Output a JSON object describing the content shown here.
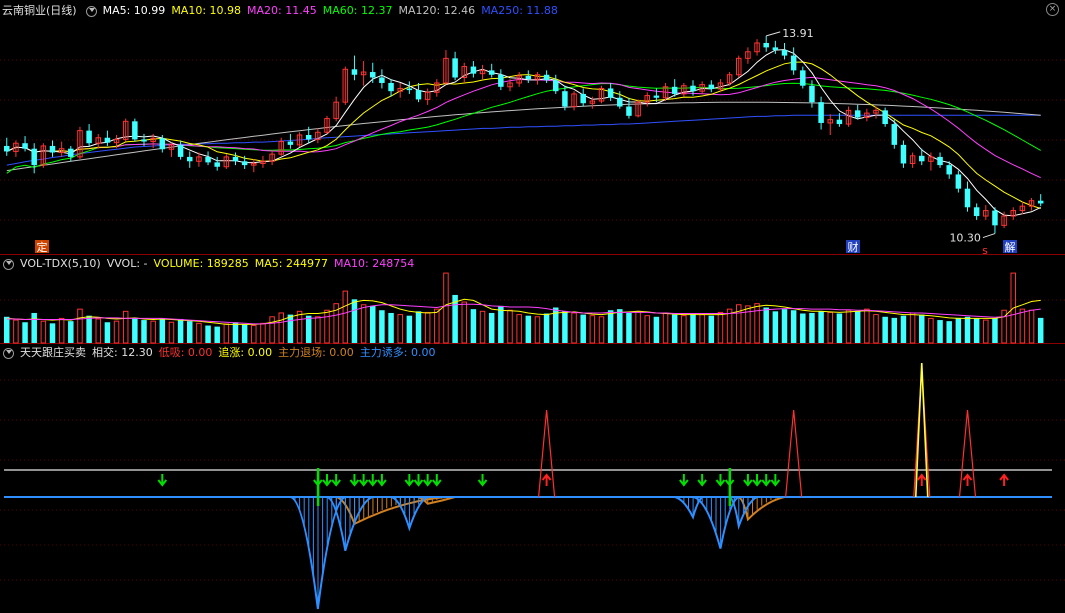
{
  "main_legend": {
    "title": "云南铜业(日线)",
    "ma": [
      {
        "label": "MA5: 10.99",
        "color": "#ffffff"
      },
      {
        "label": "MA10: 10.98",
        "color": "#ffff00"
      },
      {
        "label": "MA20: 11.45",
        "color": "#ff40ff"
      },
      {
        "label": "MA60: 12.37",
        "color": "#00ff00"
      },
      {
        "label": "MA120: 12.46",
        "color": "#c0c0c0"
      },
      {
        "label": "MA250: 11.88",
        "color": "#3050ff"
      }
    ]
  },
  "vol_legend": {
    "title": "VOL-TDX(5,10)",
    "items": [
      {
        "label": "VVOL: -",
        "color": "#e0e0e0"
      },
      {
        "label": "VOLUME: 189285",
        "color": "#ffff00"
      },
      {
        "label": "MA5: 244977",
        "color": "#ffff00"
      },
      {
        "label": "MA10: 248754",
        "color": "#ff40ff"
      }
    ]
  },
  "ind_legend": {
    "title": "天天跟庄买卖",
    "items": [
      {
        "label": "相交: 12.30",
        "color": "#e0e0e0"
      },
      {
        "label": "低吸: 0.00",
        "color": "#ff3030"
      },
      {
        "label": "追涨: 0.00",
        "color": "#ffff00"
      },
      {
        "label": "主力退场: 0.00",
        "color": "#d08020"
      },
      {
        "label": "主力诱多: 0.00",
        "color": "#3090ff"
      }
    ]
  },
  "annotations": {
    "high_label": "13.91",
    "low_label": "10.30",
    "marker_ding": "定",
    "marker_cai": "财",
    "marker_s": "s",
    "marker_jie": "解"
  },
  "chart_data": {
    "type": "candlestick",
    "candles": [
      {
        "o": 11.9,
        "h": 12.05,
        "l": 11.72,
        "c": 11.8
      },
      {
        "o": 11.8,
        "h": 12.0,
        "l": 11.7,
        "c": 11.95
      },
      {
        "o": 11.95,
        "h": 12.08,
        "l": 11.8,
        "c": 11.85
      },
      {
        "o": 11.85,
        "h": 11.95,
        "l": 11.4,
        "c": 11.55
      },
      {
        "o": 11.55,
        "h": 11.95,
        "l": 11.5,
        "c": 11.9
      },
      {
        "o": 11.9,
        "h": 12.0,
        "l": 11.7,
        "c": 11.78
      },
      {
        "o": 11.78,
        "h": 11.98,
        "l": 11.7,
        "c": 11.85
      },
      {
        "o": 11.85,
        "h": 11.9,
        "l": 11.62,
        "c": 11.7
      },
      {
        "o": 11.7,
        "h": 12.25,
        "l": 11.66,
        "c": 12.18
      },
      {
        "o": 12.18,
        "h": 12.3,
        "l": 11.9,
        "c": 11.95
      },
      {
        "o": 11.95,
        "h": 12.12,
        "l": 11.85,
        "c": 12.05
      },
      {
        "o": 12.05,
        "h": 12.18,
        "l": 11.9,
        "c": 11.96
      },
      {
        "o": 11.96,
        "h": 12.1,
        "l": 11.86,
        "c": 12.02
      },
      {
        "o": 12.02,
        "h": 12.4,
        "l": 11.98,
        "c": 12.35
      },
      {
        "o": 12.35,
        "h": 12.4,
        "l": 11.98,
        "c": 12.02
      },
      {
        "o": 12.02,
        "h": 12.12,
        "l": 11.9,
        "c": 11.98
      },
      {
        "o": 11.98,
        "h": 12.12,
        "l": 11.86,
        "c": 12.04
      },
      {
        "o": 12.04,
        "h": 12.1,
        "l": 11.78,
        "c": 11.84
      },
      {
        "o": 11.84,
        "h": 11.96,
        "l": 11.7,
        "c": 11.92
      },
      {
        "o": 11.92,
        "h": 12.0,
        "l": 11.65,
        "c": 11.7
      },
      {
        "o": 11.7,
        "h": 11.8,
        "l": 11.5,
        "c": 11.62
      },
      {
        "o": 11.62,
        "h": 11.78,
        "l": 11.52,
        "c": 11.7
      },
      {
        "o": 11.7,
        "h": 11.8,
        "l": 11.55,
        "c": 11.6
      },
      {
        "o": 11.6,
        "h": 11.7,
        "l": 11.45,
        "c": 11.52
      },
      {
        "o": 11.52,
        "h": 11.75,
        "l": 11.48,
        "c": 11.7
      },
      {
        "o": 11.7,
        "h": 11.78,
        "l": 11.55,
        "c": 11.62
      },
      {
        "o": 11.62,
        "h": 11.72,
        "l": 11.48,
        "c": 11.55
      },
      {
        "o": 11.55,
        "h": 11.66,
        "l": 11.42,
        "c": 11.58
      },
      {
        "o": 11.58,
        "h": 11.72,
        "l": 11.5,
        "c": 11.62
      },
      {
        "o": 11.62,
        "h": 11.82,
        "l": 11.55,
        "c": 11.75
      },
      {
        "o": 11.75,
        "h": 12.05,
        "l": 11.72,
        "c": 11.98
      },
      {
        "o": 11.98,
        "h": 12.12,
        "l": 11.85,
        "c": 11.92
      },
      {
        "o": 11.92,
        "h": 12.15,
        "l": 11.88,
        "c": 12.1
      },
      {
        "o": 12.1,
        "h": 12.25,
        "l": 11.95,
        "c": 12.02
      },
      {
        "o": 12.02,
        "h": 12.22,
        "l": 11.95,
        "c": 12.15
      },
      {
        "o": 12.15,
        "h": 12.45,
        "l": 12.12,
        "c": 12.4
      },
      {
        "o": 12.4,
        "h": 12.8,
        "l": 12.35,
        "c": 12.7
      },
      {
        "o": 12.7,
        "h": 13.35,
        "l": 12.65,
        "c": 13.3
      },
      {
        "o": 13.3,
        "h": 13.55,
        "l": 13.1,
        "c": 13.2
      },
      {
        "o": 13.2,
        "h": 13.45,
        "l": 13.0,
        "c": 13.25
      },
      {
        "o": 13.25,
        "h": 13.42,
        "l": 13.05,
        "c": 13.15
      },
      {
        "o": 13.15,
        "h": 13.3,
        "l": 12.95,
        "c": 13.05
      },
      {
        "o": 13.05,
        "h": 13.12,
        "l": 12.8,
        "c": 12.9
      },
      {
        "o": 12.9,
        "h": 13.05,
        "l": 12.78,
        "c": 12.95
      },
      {
        "o": 12.95,
        "h": 13.08,
        "l": 12.85,
        "c": 12.92
      },
      {
        "o": 12.92,
        "h": 13.05,
        "l": 12.7,
        "c": 12.75
      },
      {
        "o": 12.75,
        "h": 12.95,
        "l": 12.65,
        "c": 12.88
      },
      {
        "o": 12.88,
        "h": 13.12,
        "l": 12.8,
        "c": 13.05
      },
      {
        "o": 13.05,
        "h": 13.65,
        "l": 13.02,
        "c": 13.5
      },
      {
        "o": 13.5,
        "h": 13.62,
        "l": 13.1,
        "c": 13.15
      },
      {
        "o": 13.15,
        "h": 13.42,
        "l": 13.05,
        "c": 13.35
      },
      {
        "o": 13.35,
        "h": 13.45,
        "l": 13.15,
        "c": 13.22
      },
      {
        "o": 13.22,
        "h": 13.38,
        "l": 13.12,
        "c": 13.28
      },
      {
        "o": 13.28,
        "h": 13.4,
        "l": 13.15,
        "c": 13.2
      },
      {
        "o": 13.2,
        "h": 13.3,
        "l": 12.92,
        "c": 12.98
      },
      {
        "o": 12.98,
        "h": 13.12,
        "l": 12.9,
        "c": 13.05
      },
      {
        "o": 13.05,
        "h": 13.25,
        "l": 12.98,
        "c": 13.18
      },
      {
        "o": 13.18,
        "h": 13.28,
        "l": 13.05,
        "c": 13.12
      },
      {
        "o": 13.12,
        "h": 13.25,
        "l": 13.02,
        "c": 13.2
      },
      {
        "o": 13.2,
        "h": 13.28,
        "l": 13.05,
        "c": 13.1
      },
      {
        "o": 13.1,
        "h": 13.2,
        "l": 12.85,
        "c": 12.9
      },
      {
        "o": 12.9,
        "h": 13.0,
        "l": 12.55,
        "c": 12.62
      },
      {
        "o": 12.62,
        "h": 12.9,
        "l": 12.55,
        "c": 12.85
      },
      {
        "o": 12.85,
        "h": 12.95,
        "l": 12.62,
        "c": 12.68
      },
      {
        "o": 12.68,
        "h": 12.8,
        "l": 12.58,
        "c": 12.72
      },
      {
        "o": 12.72,
        "h": 13.0,
        "l": 12.68,
        "c": 12.95
      },
      {
        "o": 12.95,
        "h": 13.05,
        "l": 12.72,
        "c": 12.78
      },
      {
        "o": 12.78,
        "h": 12.9,
        "l": 12.58,
        "c": 12.62
      },
      {
        "o": 12.62,
        "h": 12.78,
        "l": 12.4,
        "c": 12.45
      },
      {
        "o": 12.45,
        "h": 12.75,
        "l": 12.42,
        "c": 12.7
      },
      {
        "o": 12.7,
        "h": 12.88,
        "l": 12.62,
        "c": 12.82
      },
      {
        "o": 12.82,
        "h": 12.95,
        "l": 12.7,
        "c": 12.78
      },
      {
        "o": 12.78,
        "h": 13.05,
        "l": 12.72,
        "c": 12.98
      },
      {
        "o": 12.98,
        "h": 13.12,
        "l": 12.8,
        "c": 12.85
      },
      {
        "o": 12.85,
        "h": 13.05,
        "l": 12.8,
        "c": 13.0
      },
      {
        "o": 13.0,
        "h": 13.1,
        "l": 12.82,
        "c": 12.9
      },
      {
        "o": 12.9,
        "h": 13.08,
        "l": 12.85,
        "c": 13.02
      },
      {
        "o": 13.02,
        "h": 13.1,
        "l": 12.88,
        "c": 12.94
      },
      {
        "o": 12.94,
        "h": 13.12,
        "l": 12.88,
        "c": 13.05
      },
      {
        "o": 13.05,
        "h": 13.25,
        "l": 13.0,
        "c": 13.2
      },
      {
        "o": 13.2,
        "h": 13.55,
        "l": 13.15,
        "c": 13.5
      },
      {
        "o": 13.5,
        "h": 13.7,
        "l": 13.4,
        "c": 13.62
      },
      {
        "o": 13.62,
        "h": 13.85,
        "l": 13.55,
        "c": 13.78
      },
      {
        "o": 13.78,
        "h": 13.91,
        "l": 13.62,
        "c": 13.7
      },
      {
        "o": 13.7,
        "h": 13.82,
        "l": 13.58,
        "c": 13.65
      },
      {
        "o": 13.65,
        "h": 13.78,
        "l": 13.48,
        "c": 13.55
      },
      {
        "o": 13.55,
        "h": 13.7,
        "l": 13.2,
        "c": 13.28
      },
      {
        "o": 13.28,
        "h": 13.35,
        "l": 12.95,
        "c": 13.0
      },
      {
        "o": 13.0,
        "h": 13.1,
        "l": 12.6,
        "c": 12.7
      },
      {
        "o": 12.7,
        "h": 12.8,
        "l": 12.2,
        "c": 12.32
      },
      {
        "o": 12.32,
        "h": 12.48,
        "l": 12.1,
        "c": 12.38
      },
      {
        "o": 12.38,
        "h": 12.5,
        "l": 12.25,
        "c": 12.3
      },
      {
        "o": 12.3,
        "h": 12.62,
        "l": 12.25,
        "c": 12.55
      },
      {
        "o": 12.55,
        "h": 12.65,
        "l": 12.38,
        "c": 12.42
      },
      {
        "o": 12.42,
        "h": 12.58,
        "l": 12.35,
        "c": 12.5
      },
      {
        "o": 12.5,
        "h": 12.62,
        "l": 12.4,
        "c": 12.55
      },
      {
        "o": 12.55,
        "h": 12.6,
        "l": 12.25,
        "c": 12.3
      },
      {
        "o": 12.3,
        "h": 12.38,
        "l": 11.85,
        "c": 11.92
      },
      {
        "o": 11.92,
        "h": 12.0,
        "l": 11.5,
        "c": 11.58
      },
      {
        "o": 11.58,
        "h": 11.78,
        "l": 11.5,
        "c": 11.72
      },
      {
        "o": 11.72,
        "h": 11.85,
        "l": 11.55,
        "c": 11.62
      },
      {
        "o": 11.62,
        "h": 11.78,
        "l": 11.45,
        "c": 11.7
      },
      {
        "o": 11.7,
        "h": 11.78,
        "l": 11.5,
        "c": 11.55
      },
      {
        "o": 11.55,
        "h": 11.62,
        "l": 11.3,
        "c": 11.38
      },
      {
        "o": 11.38,
        "h": 11.45,
        "l": 11.05,
        "c": 11.12
      },
      {
        "o": 11.12,
        "h": 11.25,
        "l": 10.7,
        "c": 10.78
      },
      {
        "o": 10.78,
        "h": 10.85,
        "l": 10.55,
        "c": 10.62
      },
      {
        "o": 10.62,
        "h": 10.82,
        "l": 10.55,
        "c": 10.72
      },
      {
        "o": 10.72,
        "h": 10.78,
        "l": 10.3,
        "c": 10.45
      },
      {
        "o": 10.45,
        "h": 10.7,
        "l": 10.4,
        "c": 10.62
      },
      {
        "o": 10.62,
        "h": 10.78,
        "l": 10.55,
        "c": 10.72
      },
      {
        "o": 10.72,
        "h": 10.88,
        "l": 10.65,
        "c": 10.8
      },
      {
        "o": 10.8,
        "h": 10.95,
        "l": 10.72,
        "c": 10.9
      },
      {
        "o": 10.9,
        "h": 11.02,
        "l": 10.8,
        "c": 10.85
      }
    ],
    "ma250": [
      11.55,
      11.58,
      11.61,
      11.64,
      11.66,
      11.69,
      11.71,
      11.74,
      11.76,
      11.78,
      11.8,
      11.82,
      11.84,
      11.86,
      11.88,
      11.89,
      11.9,
      11.91,
      11.92,
      11.93,
      11.93,
      11.94,
      11.94,
      11.95,
      11.95,
      11.96,
      11.96,
      11.97,
      11.97,
      11.98,
      11.99,
      12.0,
      12.01,
      12.02,
      12.04,
      12.05,
      12.06,
      12.07,
      12.08,
      12.09,
      12.1,
      12.11,
      12.12,
      12.13,
      12.14,
      12.15,
      12.16,
      12.17,
      12.18,
      12.19,
      12.2,
      12.21,
      12.22,
      12.22,
      12.23,
      12.24,
      12.24,
      12.25,
      12.25,
      12.26,
      12.26,
      12.27,
      12.27,
      12.28,
      12.28,
      12.29,
      12.29,
      12.3,
      12.3,
      12.31,
      12.32,
      12.33,
      12.34,
      12.35,
      12.36,
      12.37,
      12.38,
      12.39,
      12.4,
      12.41,
      12.42,
      12.43,
      12.44,
      12.44,
      12.45,
      12.45,
      12.46,
      12.46,
      12.46,
      12.46,
      12.46,
      12.46,
      12.46,
      12.46,
      12.46,
      12.46,
      12.46,
      12.46,
      12.46,
      12.46,
      12.46,
      12.46,
      12.46,
      12.46,
      12.46,
      12.46,
      12.46,
      12.46,
      12.46,
      12.46,
      12.46,
      12.46,
      12.46,
      12.46
    ],
    "volume": [
      48,
      42,
      38,
      55,
      40,
      36,
      45,
      40,
      62,
      50,
      44,
      38,
      40,
      58,
      46,
      42,
      40,
      45,
      38,
      44,
      40,
      36,
      32,
      30,
      35,
      38,
      34,
      32,
      36,
      48,
      55,
      52,
      58,
      50,
      48,
      60,
      72,
      95,
      80,
      70,
      68,
      60,
      55,
      52,
      50,
      58,
      56,
      62,
      128,
      88,
      75,
      62,
      58,
      55,
      68,
      60,
      52,
      50,
      48,
      54,
      65,
      58,
      55,
      52,
      50,
      48,
      60,
      62,
      55,
      58,
      50,
      48,
      55,
      52,
      50,
      54,
      52,
      50,
      56,
      62,
      70,
      68,
      72,
      65,
      58,
      62,
      60,
      54,
      55,
      58,
      56,
      54,
      60,
      58,
      62,
      52,
      48,
      46,
      50,
      55,
      52,
      45,
      42,
      40,
      46,
      48,
      45,
      42,
      45,
      60,
      128,
      62,
      60,
      46
    ],
    "volume_ma5": [
      45,
      44,
      43,
      44,
      43,
      42,
      43,
      42,
      46,
      48,
      47,
      45,
      44,
      45,
      46,
      44,
      43,
      44,
      43,
      42,
      41,
      40,
      38,
      36,
      34,
      34,
      34,
      34,
      35,
      38,
      42,
      48,
      52,
      54,
      54,
      56,
      60,
      68,
      75,
      78,
      77,
      74,
      68,
      62,
      58,
      56,
      55,
      56,
      70,
      75,
      80,
      78,
      70,
      62,
      60,
      59,
      58,
      55,
      53,
      52,
      55,
      56,
      57,
      55,
      53,
      52,
      54,
      56,
      57,
      58,
      57,
      55,
      54,
      53,
      52,
      52,
      52,
      52,
      52,
      54,
      58,
      63,
      67,
      69,
      68,
      66,
      63,
      60,
      58,
      58,
      57,
      56,
      57,
      58,
      59,
      58,
      56,
      54,
      52,
      52,
      51,
      50,
      48,
      46,
      45,
      45,
      45,
      45,
      45,
      48,
      64,
      70,
      76,
      78
    ],
    "volume_ma10": [
      44,
      44,
      43,
      43,
      43,
      43,
      43,
      43,
      44,
      45,
      46,
      46,
      46,
      45,
      45,
      45,
      45,
      45,
      44,
      43,
      42,
      41,
      40,
      39,
      38,
      37,
      36,
      35,
      35,
      36,
      38,
      41,
      43,
      45,
      46,
      48,
      51,
      55,
      60,
      65,
      68,
      70,
      70,
      69,
      68,
      67,
      66,
      65,
      68,
      70,
      71,
      71,
      70,
      68,
      67,
      66,
      66,
      66,
      65,
      63,
      60,
      58,
      56,
      55,
      55,
      55,
      56,
      56,
      56,
      56,
      56,
      55,
      55,
      54,
      54,
      54,
      54,
      54,
      54,
      54,
      55,
      57,
      59,
      61,
      62,
      63,
      63,
      63,
      62,
      62,
      62,
      61,
      61,
      60,
      60,
      59,
      58,
      57,
      56,
      55,
      55,
      54,
      53,
      52,
      51,
      50,
      49,
      48,
      47,
      48,
      52,
      56,
      60,
      62
    ],
    "signals": {
      "buy_arrows": [
        59,
        100,
        105,
        109
      ],
      "sell_arrows": [
        17,
        34,
        35,
        36,
        38,
        39,
        40,
        41,
        44,
        45,
        46,
        47,
        52,
        74,
        76,
        78,
        79,
        81,
        82,
        83,
        84
      ],
      "red_spikes": [
        59,
        86,
        100,
        105
      ],
      "yellow_spikes": [
        100
      ],
      "green_bars": [
        34,
        79
      ],
      "blue_dips": [
        {
          "s": 31,
          "e": 37,
          "peak": 34,
          "d": 1.0
        },
        {
          "s": 35,
          "e": 40,
          "peak": 37,
          "d": 0.48
        },
        {
          "s": 42,
          "e": 46,
          "peak": 44,
          "d": 0.28
        },
        {
          "s": 73,
          "e": 76,
          "peak": 75,
          "d": 0.18
        },
        {
          "s": 75,
          "e": 80,
          "peak": 78,
          "d": 0.46
        },
        {
          "s": 79,
          "e": 82,
          "peak": 80,
          "d": 0.26
        }
      ],
      "orange_dips": [
        {
          "s": 36,
          "e": 48,
          "peak": 38,
          "d": 0.24
        },
        {
          "s": 45,
          "e": 49,
          "peak": 46,
          "d": 0.06
        },
        {
          "s": 80,
          "e": 85,
          "peak": 81,
          "d": 0.2
        }
      ],
      "line_level": 12.3
    }
  }
}
